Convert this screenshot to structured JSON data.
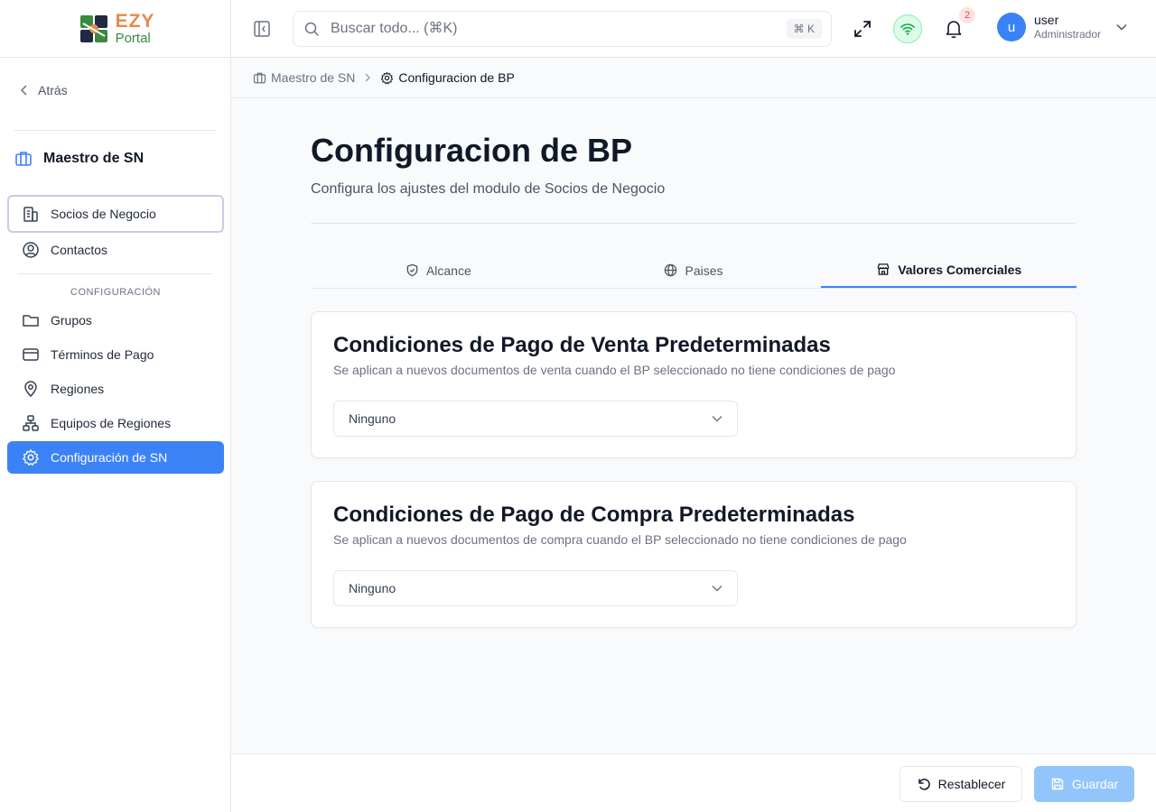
{
  "brand": {
    "line1": "EZY",
    "line2": "Portal"
  },
  "sidebar": {
    "back_label": "Atrás",
    "section_title": "Maestro de SN",
    "items": [
      {
        "label": "Socios de Negocio"
      },
      {
        "label": "Contactos"
      }
    ],
    "group_label": "CONFIGURACIÓN",
    "config_items": [
      {
        "label": "Grupos"
      },
      {
        "label": "Términos de Pago"
      },
      {
        "label": "Regiones"
      },
      {
        "label": "Equipos de Regiones"
      },
      {
        "label": "Configuración de SN"
      }
    ]
  },
  "header": {
    "search_placeholder": "Buscar todo... (⌘K)",
    "search_shortcut": "⌘ K",
    "notification_count": "2",
    "user": {
      "initial": "u",
      "name": "user",
      "role": "Administrador"
    }
  },
  "breadcrumb": {
    "parent": "Maestro de SN",
    "current": "Configuracion de BP"
  },
  "page": {
    "title": "Configuracion de BP",
    "subtitle": "Configura los ajustes del modulo de Socios de Negocio"
  },
  "tabs": [
    {
      "label": "Alcance"
    },
    {
      "label": "Paises"
    },
    {
      "label": "Valores Comerciales"
    }
  ],
  "cards": [
    {
      "title": "Condiciones de Pago de Venta Predeterminadas",
      "description": "Se aplican a nuevos documentos de venta cuando el BP seleccionado no tiene condiciones de pago",
      "selected": "Ninguno"
    },
    {
      "title": "Condiciones de Pago de Compra Predeterminadas",
      "description": "Se aplican a nuevos documentos de compra cuando el BP seleccionado no tiene condiciones de pago",
      "selected": "Ninguno"
    }
  ],
  "footer": {
    "reset_label": "Restablecer",
    "save_label": "Guardar"
  },
  "colors": {
    "accent": "#3b82f6",
    "save_disabled": "#93c5fd",
    "brand_orange": "#e8894a",
    "brand_green": "#3a8a3f"
  }
}
